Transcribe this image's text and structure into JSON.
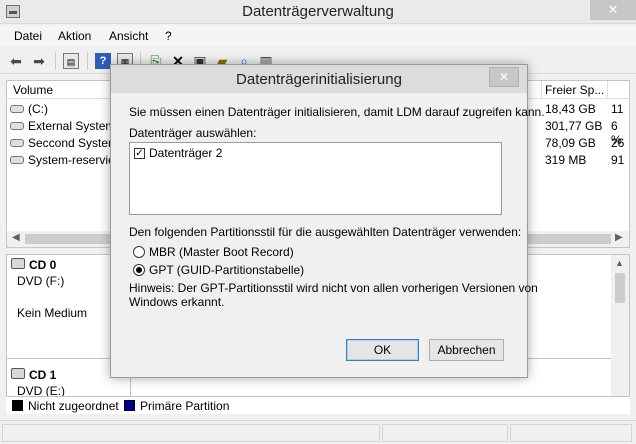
{
  "window": {
    "title": "Datenträgerverwaltung",
    "close_glyph": "✕"
  },
  "menu": [
    "Datei",
    "Aktion",
    "Ansicht",
    "?"
  ],
  "volumes": {
    "headers": {
      "volume": "Volume",
      "free": "Freier Sp..."
    },
    "rows": [
      {
        "name": "(C:)",
        "free": "18,43 GB",
        "pct": "11"
      },
      {
        "name": "External System",
        "free": "301,77 GB",
        "pct": "6 %"
      },
      {
        "name": "Seccond System",
        "free": "78,09 GB",
        "pct": "26"
      },
      {
        "name": "System-reservie",
        "free": "319 MB",
        "pct": "91"
      }
    ]
  },
  "disks": [
    {
      "name": "CD 0",
      "type": "DVD (F:)",
      "media": "Kein Medium"
    },
    {
      "name": "CD 1",
      "type": "DVD (E:)"
    }
  ],
  "legend": [
    {
      "label": "Nicht zugeordnet",
      "color": "#000000"
    },
    {
      "label": "Primäre Partition",
      "color": "#00008b"
    }
  ],
  "dialog": {
    "title": "Datenträgerinitialisierung",
    "intro": "Sie müssen einen Datenträger initialisieren, damit LDM darauf zugreifen kann.",
    "select_label": "Datenträger auswählen:",
    "disk_item": "Datenträger 2",
    "partition_prompt": "Den folgenden Partitionsstil für die ausgewählten Datenträger verwenden:",
    "option_mbr": "MBR (Master Boot Record)",
    "option_gpt": "GPT (GUID-Partitionstabelle)",
    "selected_option": "gpt",
    "hint_line1": "Hinweis: Der GPT-Partitionsstil wird nicht von allen vorherigen Versionen von",
    "hint_line2": "Windows erkannt.",
    "ok_label": "OK",
    "cancel_label": "Abbrechen"
  }
}
